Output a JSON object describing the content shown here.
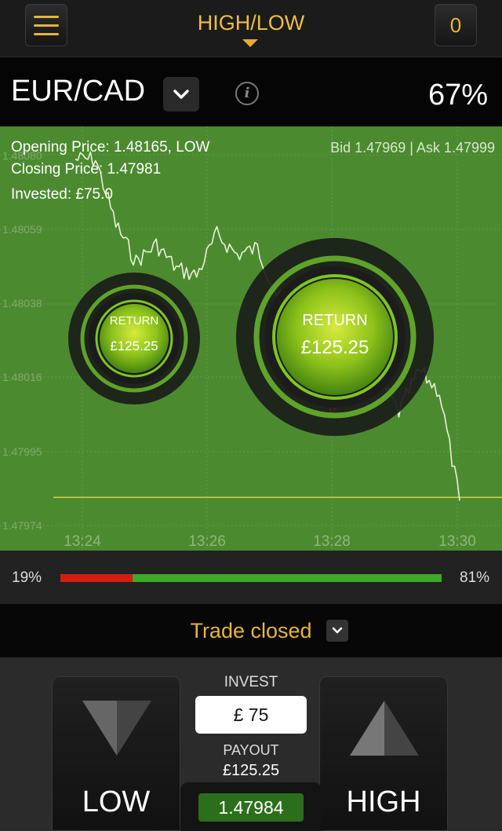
{
  "header": {
    "title": "HIGH/LOW",
    "count": "0"
  },
  "asset": {
    "name": "EUR/CAD",
    "payout_pct": "67%"
  },
  "chart": {
    "opening_price": "Opening Price: 1.48165, LOW",
    "closing_price": "Closing Price: 1.47981",
    "invested": "Invested: £75.0",
    "bid_ask": "Bid 1.47969 | Ask 1.47999",
    "y_ticks": [
      "1.48080",
      "1.48059",
      "1.48038",
      "1.48016",
      "1.47995",
      "1.47974"
    ],
    "x_ticks": [
      "13:24",
      "13:26",
      "13:28",
      "13:30"
    ],
    "return_small": {
      "label": "RETURN",
      "value": "£125.25"
    },
    "return_large": {
      "label": "RETURN",
      "value": "£125.25"
    },
    "colors": {
      "background": "#4c8a30",
      "line": "#e8f0d8",
      "strike": "#d8d040"
    }
  },
  "chart_data": {
    "type": "line",
    "x": [
      "13:23:30",
      "13:24:00",
      "13:24:15",
      "13:24:40",
      "13:25:00",
      "13:25:20",
      "13:25:40",
      "13:26:00",
      "13:26:20",
      "13:26:40",
      "13:27:00",
      "13:27:20",
      "13:27:40",
      "13:28:00",
      "13:28:20",
      "13:28:40",
      "13:29:00",
      "13:29:20",
      "13:29:40",
      "13:30:00"
    ],
    "series": [
      {
        "values": [
          1.4808,
          1.4808,
          1.48061,
          1.4805,
          1.48055,
          1.48048,
          1.48046,
          1.48058,
          1.48052,
          1.48054,
          1.4804,
          1.48034,
          1.4801,
          1.48006,
          1.48026,
          1.48016,
          1.48006,
          1.48018,
          1.48012,
          1.4798
        ]
      }
    ],
    "ylim": [
      1.4797,
      1.48085
    ],
    "strike": 1.47981,
    "grid": true
  },
  "sentiment": {
    "low_pct": "19%",
    "high_pct": "81%",
    "low_fraction": 0.19,
    "high_fraction": 0.81
  },
  "status": {
    "text": "Trade closed"
  },
  "trade": {
    "invest_label": "INVEST",
    "invest_value": "£ 75",
    "payout_label": "PAYOUT",
    "payout_value": "£125.25",
    "low_label": "LOW",
    "high_label": "HIGH",
    "current_price": "1.47984"
  }
}
